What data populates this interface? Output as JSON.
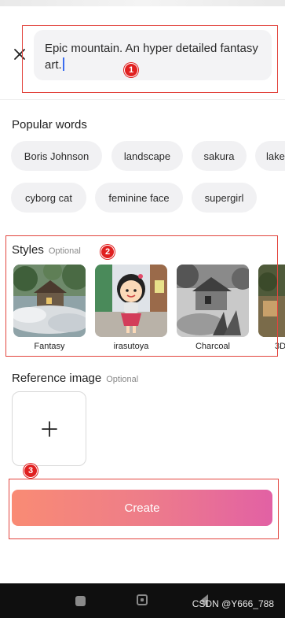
{
  "prompt": {
    "text": "Epic mountain. An hyper detailed fantasy art."
  },
  "popular_words": {
    "title": "Popular words",
    "chips": [
      "Boris Johnson",
      "landscape",
      "sakura",
      "lake",
      "cyborg cat",
      "feminine face",
      "supergirl"
    ]
  },
  "styles": {
    "title": "Styles",
    "optional": "Optional",
    "items": [
      "Fantasy",
      "irasutoya",
      "Charcoal",
      "3D"
    ]
  },
  "reference": {
    "title": "Reference image",
    "optional": "Optional"
  },
  "create_label": "Create",
  "annotations": [
    "1",
    "2",
    "3"
  ],
  "watermark": "CSDN @Y666_788",
  "colors": {
    "create_gradient_start": "#f98b74",
    "create_gradient_end": "#e261a4",
    "annotation_red": "#e02020"
  }
}
